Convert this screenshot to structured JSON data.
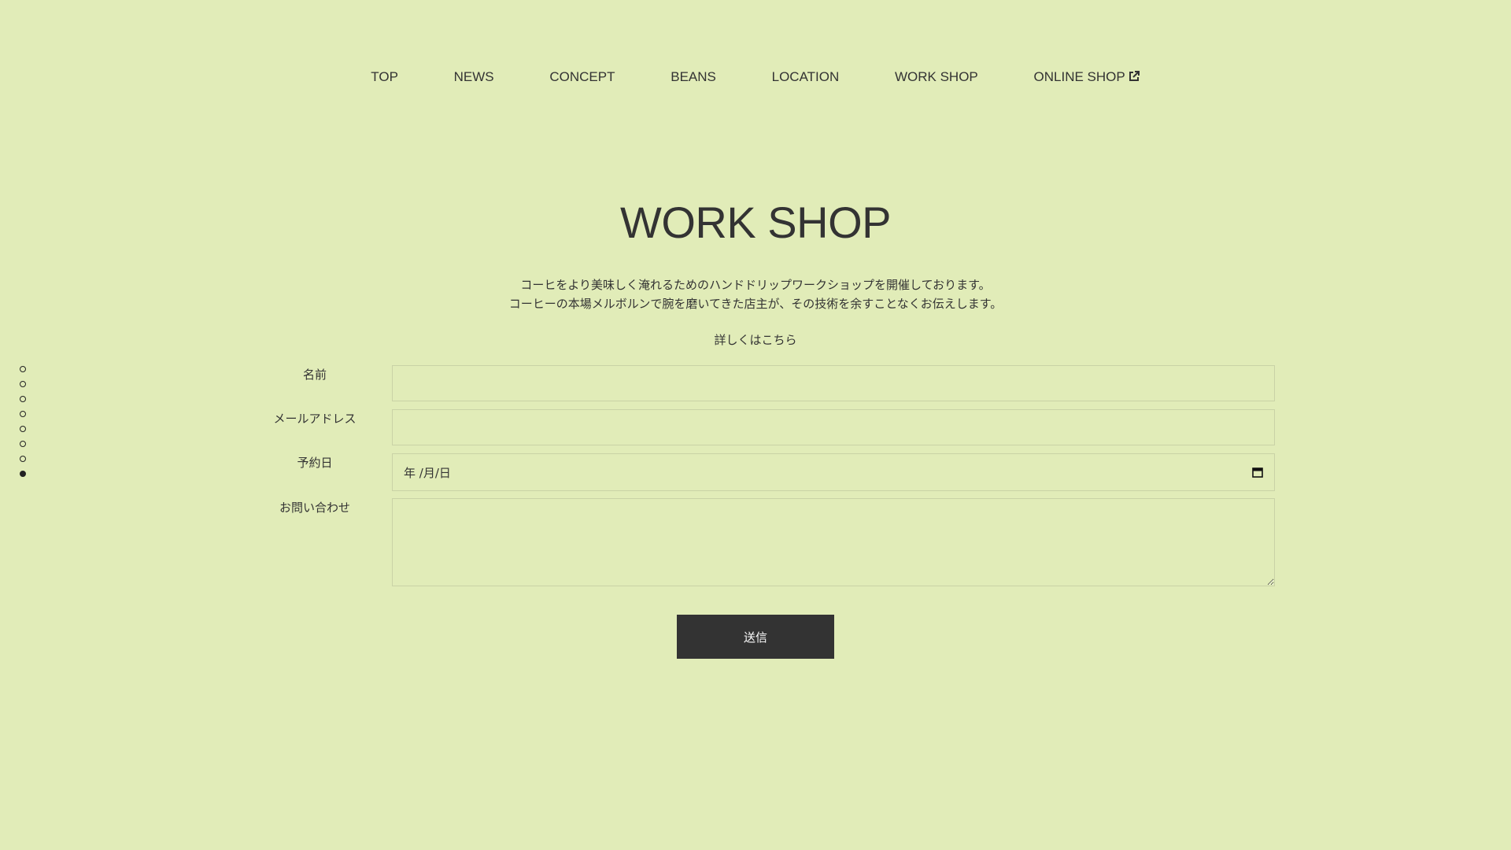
{
  "nav": {
    "items": [
      {
        "label": "TOP"
      },
      {
        "label": "NEWS"
      },
      {
        "label": "CONCEPT"
      },
      {
        "label": "BEANS"
      },
      {
        "label": "LOCATION"
      },
      {
        "label": "WORK SHOP"
      },
      {
        "label": "ONLINE SHOP",
        "icon": "external-link-icon"
      }
    ]
  },
  "main": {
    "title": "WORK SHOP",
    "description_line1": "コーヒをより美味しく淹れるためのハンドドリップワークショップを開催しております。",
    "description_line2": "コーヒーの本場メルボルンで腕を磨いてきた店主が、その技術を余すことなくお伝えします。",
    "more_link": "詳しくはこちら"
  },
  "side_indicator": {
    "count": 8,
    "active_index": 7
  },
  "form": {
    "name_label": "名前",
    "name_value": "",
    "email_label": "メールアドレス",
    "email_value": "",
    "date_label": "予約日",
    "date_value": "年 /月/日",
    "inquiry_label": "お問い合わせ",
    "inquiry_value": "",
    "submit_label": "送信"
  },
  "colors": {
    "background": "#e1ecb8",
    "text": "#333333",
    "button": "#333333"
  }
}
